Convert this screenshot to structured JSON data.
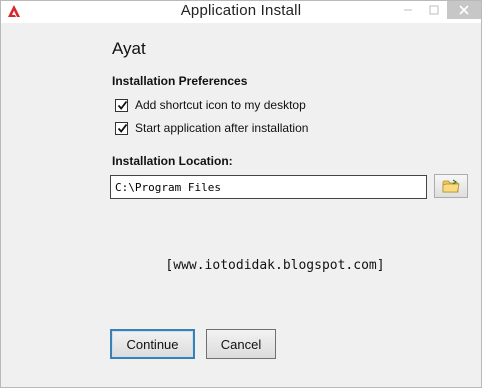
{
  "window": {
    "title": "Application Install"
  },
  "app": {
    "name": "Ayat"
  },
  "preferences": {
    "heading": "Installation Preferences",
    "options": [
      {
        "label": "Add shortcut icon to my desktop",
        "checked": true
      },
      {
        "label": "Start application after installation",
        "checked": true
      }
    ]
  },
  "location": {
    "heading": "Installation Location:",
    "value": "C:\\Program Files",
    "browse_icon": "folder-icon"
  },
  "watermark": "[www.iotodidak.blogspot.com]",
  "buttons": {
    "continue_label": "Continue",
    "cancel_label": "Cancel"
  },
  "colors": {
    "accent": "#3c7fb1",
    "brand": "#d9262b"
  }
}
